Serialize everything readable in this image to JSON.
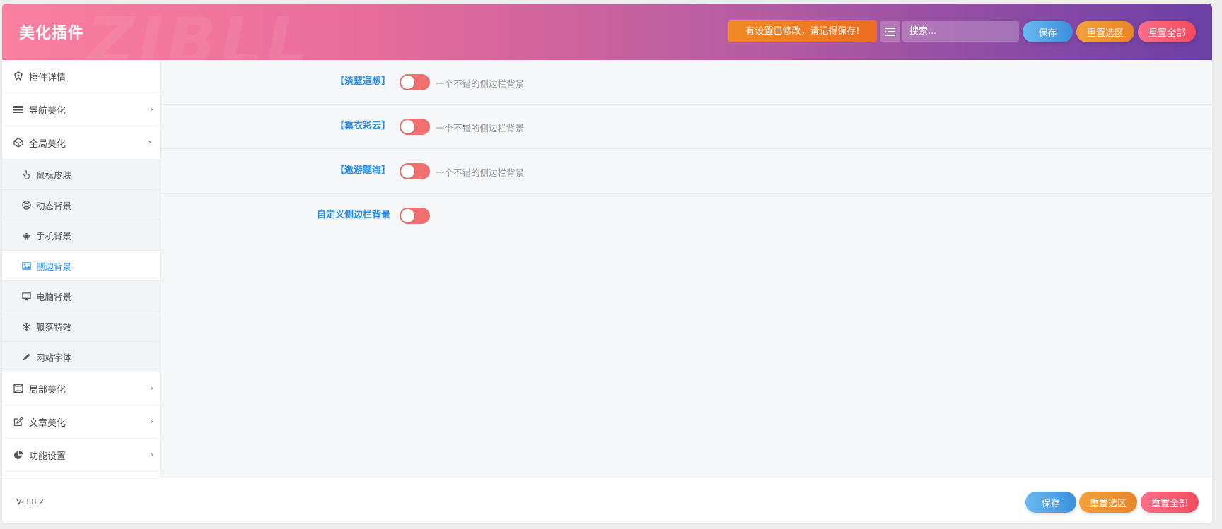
{
  "header": {
    "title": "美化插件",
    "watermark": "ZIBLL",
    "notice": "有设置已修改，请记得保存!",
    "search_placeholder": "搜索...",
    "save_label": "保存",
    "reset_section_label": "重置选区",
    "reset_all_label": "重置全部"
  },
  "sidebar": {
    "items": [
      {
        "label": "插件详情",
        "icon": "dashboard-icon"
      },
      {
        "label": "导航美化",
        "icon": "menu-bars-icon",
        "arrow": "›"
      },
      {
        "label": "全局美化",
        "icon": "cube-icon",
        "arrow": "⌄"
      }
    ],
    "subitems": [
      {
        "label": "鼠标皮肤",
        "icon": "pointer-hand-icon"
      },
      {
        "label": "动态背景",
        "icon": "life-ring-icon"
      },
      {
        "label": "手机背景",
        "icon": "android-icon"
      },
      {
        "label": "侧边背景",
        "icon": "image-icon",
        "active": true
      },
      {
        "label": "电脑背景",
        "icon": "monitor-icon"
      },
      {
        "label": "飘落特效",
        "icon": "snowflake-icon"
      },
      {
        "label": "网站字体",
        "icon": "pencil-icon"
      }
    ],
    "bottom_items": [
      {
        "label": "局部美化",
        "icon": "layout-icon",
        "arrow": "›"
      },
      {
        "label": "文章美化",
        "icon": "edit-icon",
        "arrow": "›"
      },
      {
        "label": "功能设置",
        "icon": "pie-chart-icon",
        "arrow": "›"
      }
    ]
  },
  "settings": [
    {
      "label": "【淡蓝遐想】",
      "enabled": false,
      "description": "一个不错的侧边栏背景"
    },
    {
      "label": "【熏衣彩云】",
      "enabled": false,
      "description": "一个不错的侧边栏背景"
    },
    {
      "label": "【遨游题海】",
      "enabled": false,
      "description": "一个不错的侧边栏背景"
    },
    {
      "label": "自定义侧边栏背景",
      "enabled": false,
      "description": ""
    }
  ],
  "footer": {
    "version": "V-3.8.2",
    "save_label": "保存",
    "reset_section_label": "重置选区",
    "reset_all_label": "重置全部"
  },
  "colors": {
    "accent": "#2b8de8",
    "switch_off": "#f07070",
    "notice": "#ec6d22"
  }
}
